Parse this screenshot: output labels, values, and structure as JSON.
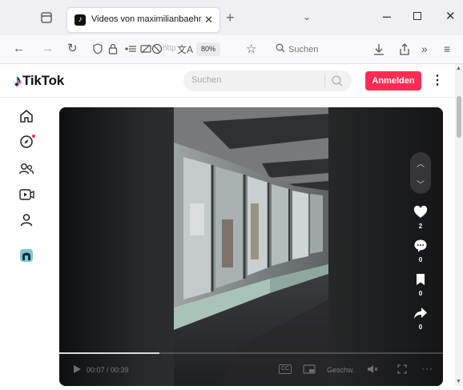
{
  "browser": {
    "tab": {
      "title": "Videos von maximilianbaehring",
      "favicon": "tiktok-favicon"
    },
    "new_tab_symbol": "+",
    "window_controls": {
      "minimize": "–",
      "maximize": "□",
      "close": "✕"
    },
    "nav": {
      "back": "←",
      "forward": "→",
      "reload": "↻",
      "url_text": "http",
      "zoom": "80%",
      "search_placeholder": "Suchen"
    }
  },
  "tiktok": {
    "logo_text": "TikTok",
    "search_placeholder": "Suchen",
    "login_label": "Anmelden",
    "more_symbol": "⋮",
    "sidebar": [
      {
        "name": "home",
        "icon": "home-icon"
      },
      {
        "name": "explore",
        "icon": "compass-icon"
      },
      {
        "name": "following",
        "icon": "users-icon"
      },
      {
        "name": "live",
        "icon": "live-icon"
      },
      {
        "name": "profile",
        "icon": "user-icon"
      },
      {
        "name": "avatar",
        "icon": "avatar-icon"
      }
    ],
    "video": {
      "likes": "2",
      "comments": "0",
      "saves": "0",
      "shares": "0",
      "time": "00:07 / 00:39",
      "speed_label": "Geschw.",
      "cc_label": "CC",
      "progress": 0.26
    }
  },
  "colors": {
    "brand_red": "#fe2c55",
    "tiktok_cyan": "#25f4ee"
  }
}
